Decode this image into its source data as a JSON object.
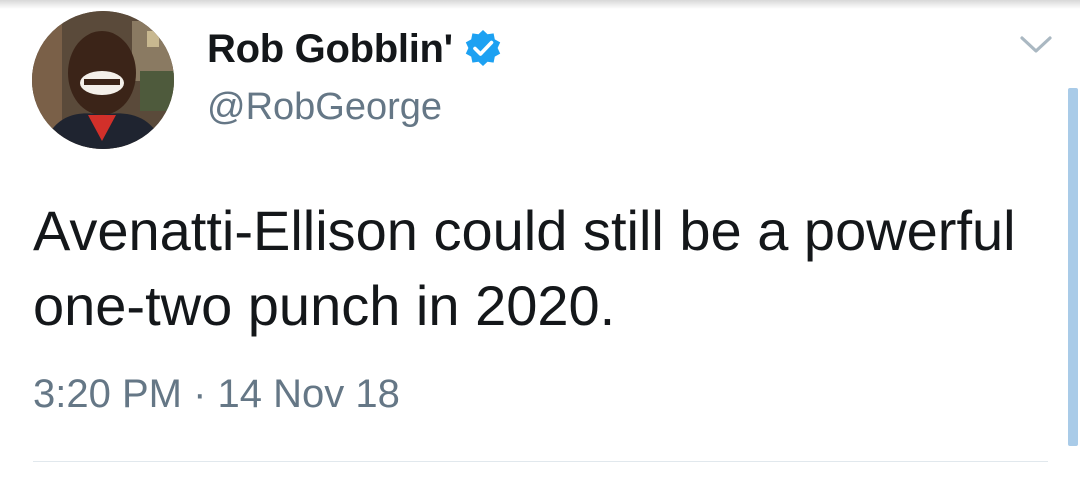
{
  "tweet": {
    "display_name": "Rob Gobblin'",
    "handle": "@RobGeorge",
    "text": "Avenatti-Ellison could still be a powerful one-two punch in 2020.",
    "timestamp": "3:20 PM · 14 Nov 18",
    "verified": true
  },
  "icons": {
    "verified": "verified-badge-icon",
    "menu": "chevron-down-icon"
  },
  "colors": {
    "verified_blue": "#1da1f2",
    "secondary_text": "#657786",
    "primary_text": "#14171a",
    "scrollbar": "#a9cbe8"
  }
}
